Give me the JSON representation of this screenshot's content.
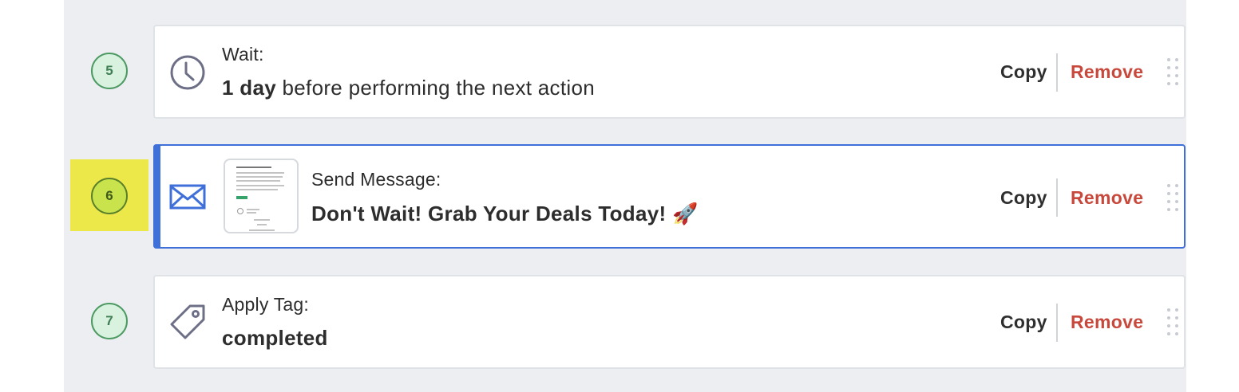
{
  "steps": [
    {
      "number": "5",
      "label": "Wait:",
      "value_bold": "1 day",
      "value_rest": " before performing the next action",
      "icon": "clock-icon",
      "copy_label": "Copy",
      "remove_label": "Remove"
    },
    {
      "number": "6",
      "label": "Send Message:",
      "value_bold": "Don't Wait! Grab Your Deals Today! 🚀",
      "icon": "envelope-icon",
      "thumbnail": "email-preview-thumbnail",
      "copy_label": "Copy",
      "remove_label": "Remove",
      "selected": true
    },
    {
      "number": "7",
      "label": "Apply Tag:",
      "value_bold": "completed",
      "icon": "tag-icon",
      "copy_label": "Copy",
      "remove_label": "Remove"
    }
  ],
  "colors": {
    "canvas_bg": "#eceef2",
    "step_badge_bg": "#d8f2df",
    "step_badge_border": "#4c9a62",
    "active_highlight": "#ece84a",
    "selected_accent": "#3f6fd8",
    "remove_text": "#c8483c"
  }
}
